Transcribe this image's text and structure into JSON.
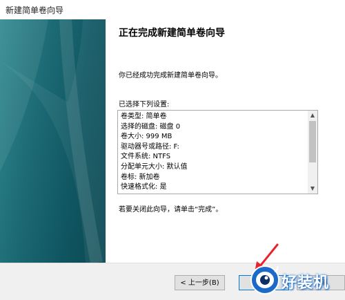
{
  "window": {
    "title": "新建简单卷向导"
  },
  "page": {
    "heading": "正在完成新建简单卷向导",
    "intro": "你已经成功完成新建简单卷向导。",
    "selected_label": "已选择下列设置:",
    "settings": [
      "卷类型: 简单卷",
      "选择的磁盘: 磁盘 0",
      "卷大小: 999 MB",
      "驱动器号或路径: F:",
      "文件系统: NTFS",
      "分配单元大小: 默认值",
      "卷标: 新加卷",
      "快速格式化: 是"
    ],
    "finish_hint": "若要关闭此向导，请单击“完成”。"
  },
  "buttons": {
    "back": "< 上一步(B)",
    "finish": "完成",
    "cancel": "取消"
  },
  "watermark": {
    "text": "好装机"
  },
  "colors": {
    "sidebar": "#1d6b75",
    "annotation_arrow": "#e8232a",
    "watermark_blue": "#1b6ac9"
  }
}
